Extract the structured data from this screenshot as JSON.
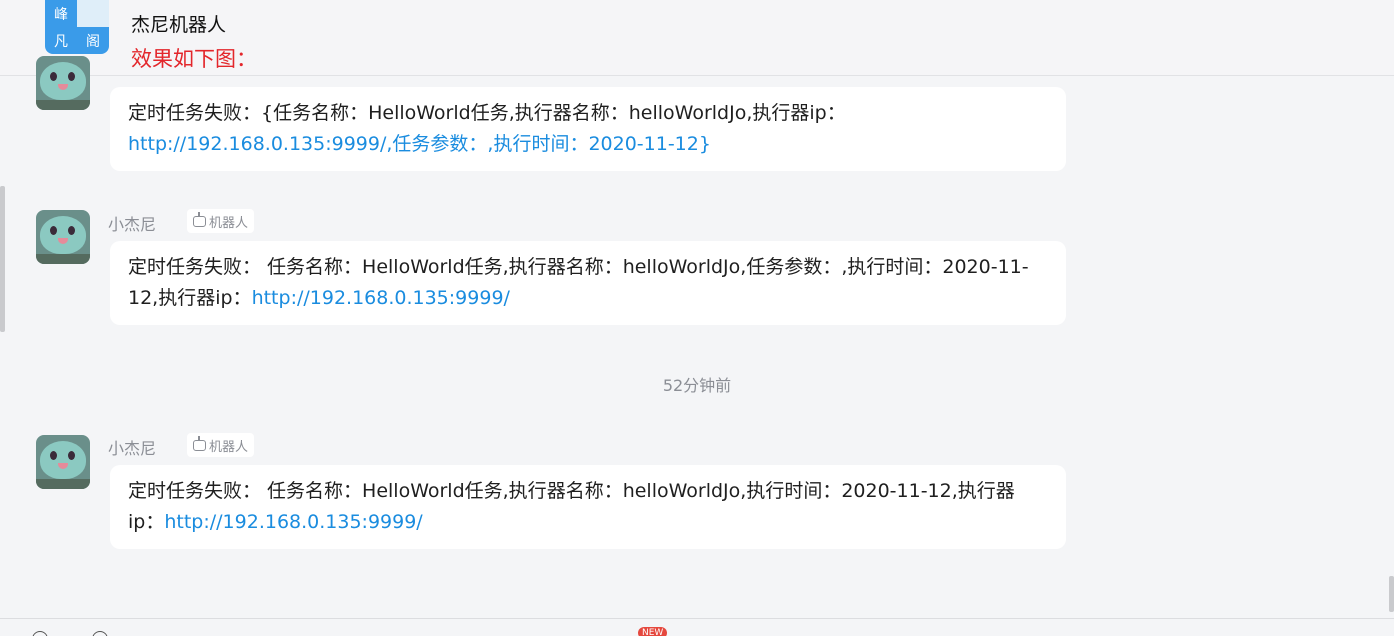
{
  "header": {
    "logo_chars": [
      "峰",
      "",
      "凡",
      "阁"
    ],
    "title": "杰尼机器人",
    "subtitle": "效果如下图："
  },
  "messages": [
    {
      "sender": "",
      "text_plain": "定时任务失败：{任务名称：HelloWorld任务,执行器名称：helloWorldJo,执行器ip：",
      "text_link": "http://192.168.0.135:9999/,任务参数：,执行时间：2020-11-12}"
    },
    {
      "sender": "小杰尼",
      "badge": "机器人",
      "text_plain": "定时任务失败： 任务名称：HelloWorld任务,执行器名称：helloWorldJo,任务参数：,执行时间：2020-11-12,执行器ip：",
      "text_link": "http://192.168.0.135:9999/"
    },
    {
      "sender": "小杰尼",
      "badge": "机器人",
      "text_plain": "定时任务失败： 任务名称：HelloWorld任务,执行器名称：helloWorldJo,执行时间：2020-11-12,执行器ip：",
      "text_link": "http://192.168.0.135:9999/"
    }
  ],
  "timestamp": "52分钟前",
  "footer": {
    "new_tag": "NEW"
  }
}
